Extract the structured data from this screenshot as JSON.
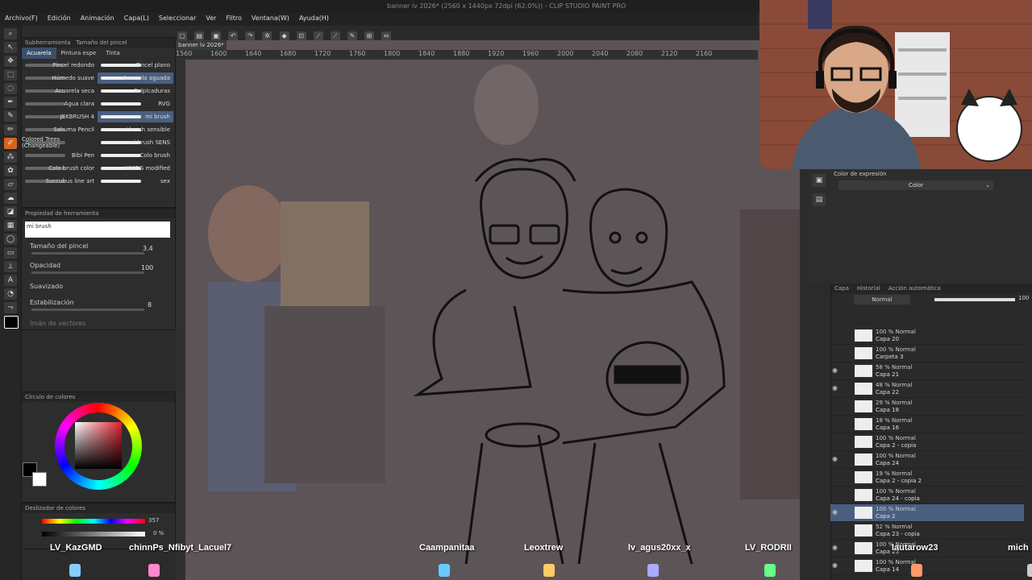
{
  "window": {
    "title": "banner lv 2026* (2560 x 1440px 72dpi (62.0%)) - CLIP STUDIO PAINT PRO"
  },
  "menu": [
    "Archivo(F)",
    "Edición",
    "Animación",
    "Capa(L)",
    "Seleccionar",
    "Ver",
    "Filtro",
    "Ventana(W)",
    "Ayuda(H)"
  ],
  "document_tab": "banner lv 2026*",
  "ruler_ticks": [
    "1560",
    "1600",
    "1640",
    "1680",
    "1720",
    "1760",
    "1800",
    "1840",
    "1880",
    "1920",
    "1960",
    "2000",
    "2040",
    "2080",
    "2120",
    "2160"
  ],
  "subtool": {
    "panel_tabs": [
      "Subherramienta",
      "Tamaño del pincel"
    ],
    "tabs": [
      "Acuarela",
      "Pintura espe",
      "Tinta"
    ],
    "brushes": [
      [
        "Pincel redondo",
        "Pincel plano"
      ],
      [
        "Húmedo suave",
        "Acuarela aguada"
      ],
      [
        "Acuarela seca",
        "Salpicaduras"
      ],
      [
        "Agua clara",
        "RVG"
      ],
      [
        "JEKBRUSH 4",
        "mi brush"
      ],
      [
        "Sakuma Pencil",
        "mi brush sensible"
      ],
      [
        "Colored Trees (Changeable)",
        "mi brush SENS"
      ],
      [
        "Bibi Pen",
        "Colo brush"
      ],
      [
        "Colo brush color",
        "HIMOG modified"
      ],
      [
        "Succubus line art",
        "sex"
      ]
    ]
  },
  "tool_property": {
    "title": "Propiedad de herramienta",
    "brush_name": "mi brush",
    "size_label": "Tamaño del pincel",
    "size_value": "3.4",
    "opacity_label": "Opacidad",
    "opacity_value": "100",
    "smoothing_label": "Suavizado",
    "stabilization_label": "Estabilización",
    "stabilization_value": "8",
    "vector_magnet_label": "Imán de vectores"
  },
  "color_wheel": {
    "title": "Círculo de colores",
    "main_color": "#000000"
  },
  "color_slider": {
    "title": "Deslizador de colores",
    "h_value": "357",
    "s_value": "0 %"
  },
  "color_expression": {
    "title": "Color de expresión",
    "mode": "Color"
  },
  "layers": {
    "tabs": [
      "Capa",
      "Historial",
      "Acción automática"
    ],
    "blend_mode": "Normal",
    "opacity": "100",
    "items": [
      {
        "line1": "100 % Normal",
        "line2": "Capa 20",
        "visible": false,
        "selected": false
      },
      {
        "line1": "100 % Normal",
        "line2": "Carpeta 3",
        "visible": false,
        "selected": false
      },
      {
        "line1": "58 % Normal",
        "line2": "Capa 21",
        "visible": true,
        "selected": false
      },
      {
        "line1": "48 % Normal",
        "line2": "Capa 22",
        "visible": true,
        "selected": false
      },
      {
        "line1": "29 % Normal",
        "line2": "Capa 18",
        "visible": false,
        "selected": false
      },
      {
        "line1": "18 % Normal",
        "line2": "Capa 16",
        "visible": false,
        "selected": false
      },
      {
        "line1": "100 % Normal",
        "line2": "Capa 2 - copia",
        "visible": false,
        "selected": false
      },
      {
        "line1": "100 % Normal",
        "line2": "Capa 24",
        "visible": true,
        "selected": false
      },
      {
        "line1": "19 % Normal",
        "line2": "Capa 2 - copia 2",
        "visible": false,
        "selected": false
      },
      {
        "line1": "100 % Normal",
        "line2": "Capa 24 - copia",
        "visible": false,
        "selected": false
      },
      {
        "line1": "100 % Normal",
        "line2": "Capa 2",
        "visible": true,
        "selected": true
      },
      {
        "line1": "52 % Normal",
        "line2": "Capa 23 - copia",
        "visible": false,
        "selected": false
      },
      {
        "line1": "100 % Normal",
        "line2": "Capa 23",
        "visible": true,
        "selected": false
      },
      {
        "line1": "100 % Normal",
        "line2": "Capa 14",
        "visible": true,
        "selected": false
      }
    ]
  },
  "chat_names": [
    "LV_KazGMD",
    "chinnPs_Nfibyt_Lacuel7",
    "Caampanitaa",
    "Leoxtrew",
    "lv_agus20xx_x",
    "LV_RODRII",
    "lautarow23",
    "mich"
  ],
  "colors": {
    "accent": "#d6641c",
    "selection": "#4a5f80",
    "visible_green": "#6ad04a"
  }
}
